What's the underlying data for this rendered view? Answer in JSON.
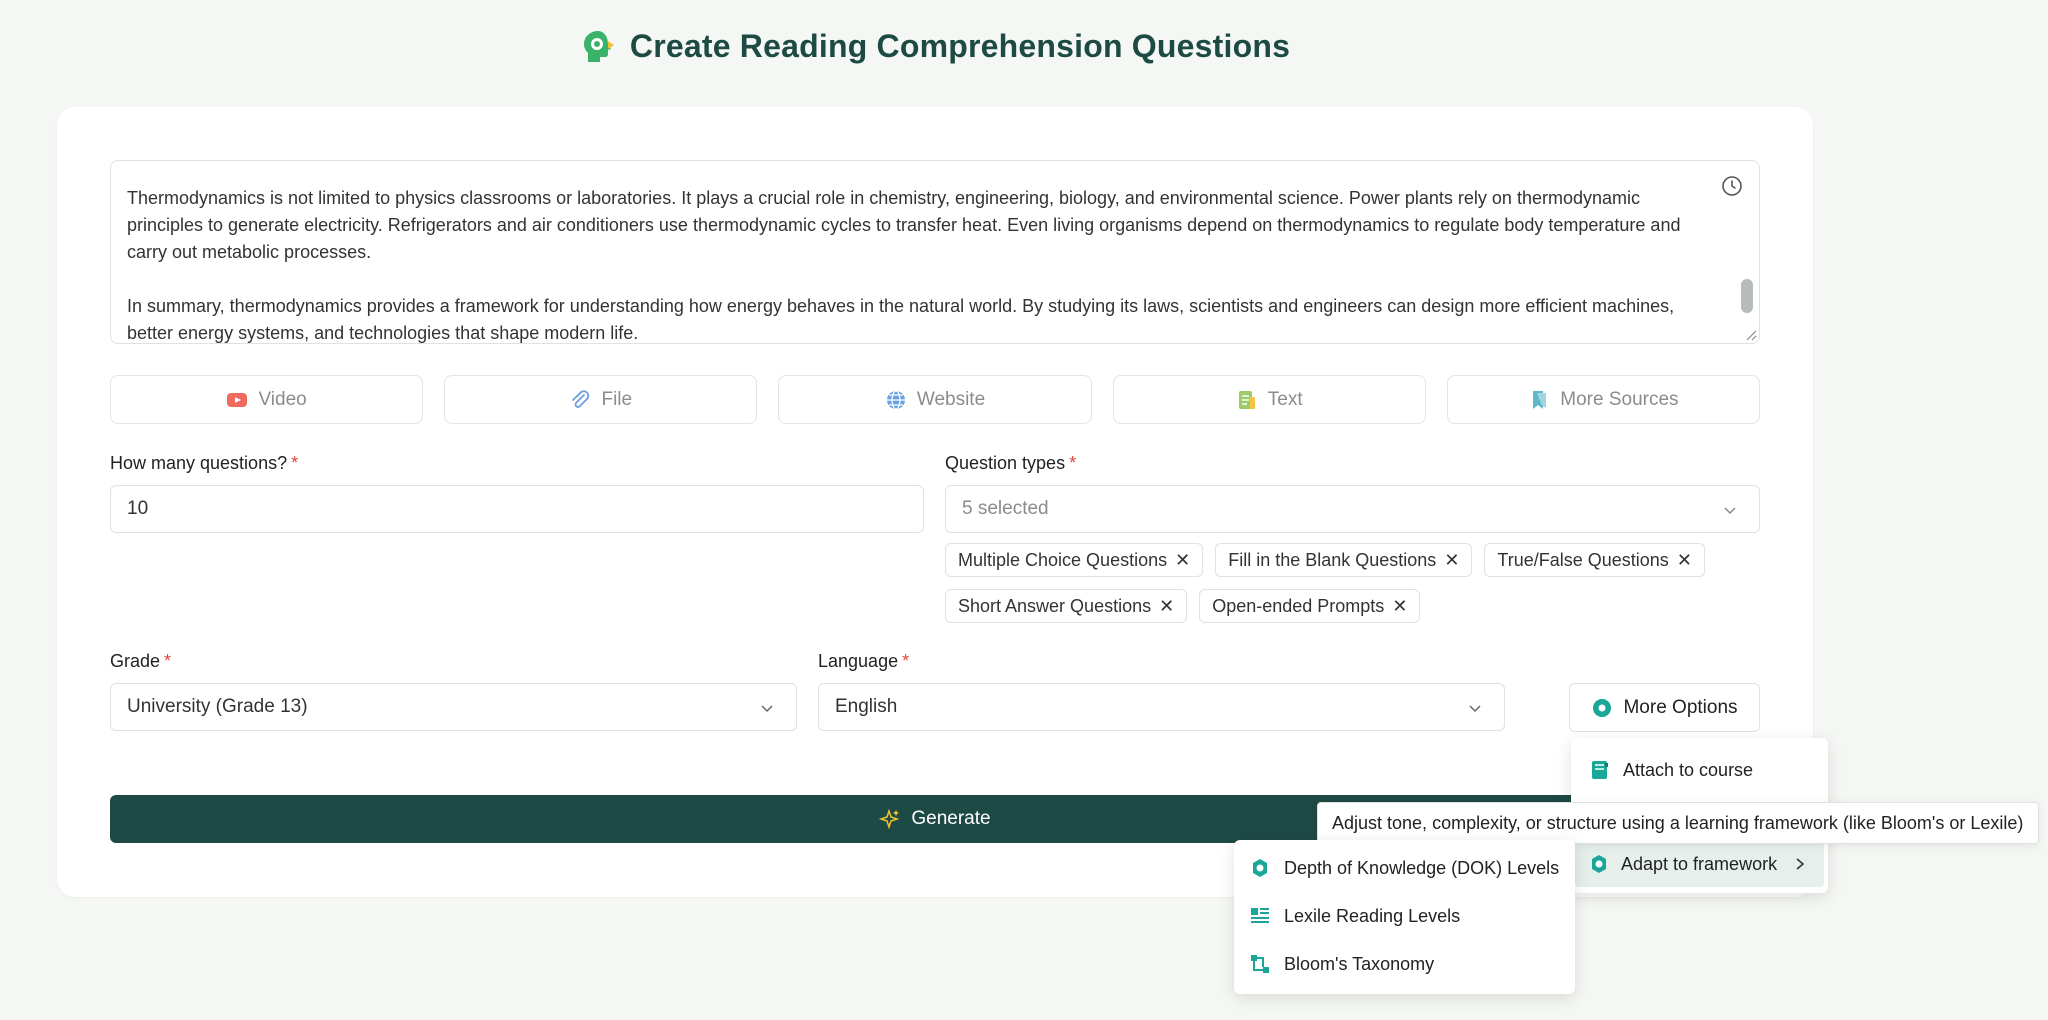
{
  "header": {
    "title": "Create Reading Comprehension Questions",
    "logo_icon": "head-gear-icon"
  },
  "source_text": {
    "paragraphs": [
      "Thermodynamics is not limited to physics classrooms or laboratories. It plays a crucial role in chemistry, engineering, biology, and environmental science. Power plants rely on thermodynamic principles to generate electricity. Refrigerators and air conditioners use thermodynamic cycles to transfer heat. Even living organisms depend on thermodynamics to regulate body temperature and carry out metabolic processes.",
      "In summary, thermodynamics provides a framework for understanding how energy behaves in the natural world. By studying its laws, scientists and engineers can design more efficient machines, better energy systems, and technologies that shape modern life."
    ]
  },
  "sources": [
    {
      "label": "Video",
      "icon": "youtube-icon"
    },
    {
      "label": "File",
      "icon": "paperclip-icon"
    },
    {
      "label": "Website",
      "icon": "globe-icon"
    },
    {
      "label": "Text",
      "icon": "text-document-icon"
    },
    {
      "label": "More Sources",
      "icon": "bookmark-icon"
    }
  ],
  "form": {
    "question_count": {
      "label": "How many questions?",
      "required_mark": "*",
      "value": "10"
    },
    "question_types": {
      "label": "Question types",
      "required_mark": "*",
      "placeholder": "5 selected",
      "chips": [
        "Multiple Choice Questions",
        "Fill in the Blank Questions",
        "True/False Questions",
        "Short Answer Questions",
        "Open-ended Prompts"
      ],
      "chip_remove": "✕"
    },
    "grade": {
      "label": "Grade",
      "required_mark": "*",
      "value": "University (Grade 13)"
    },
    "language": {
      "label": "Language",
      "required_mark": "*",
      "value": "English"
    },
    "more_options_label": "More Options",
    "generate_label": "Generate"
  },
  "more_menu": {
    "items": [
      {
        "label": "Attach to course",
        "icon": "notebook-icon"
      },
      {
        "label": "Adapt to framework",
        "icon": "framework-gear-icon"
      }
    ],
    "tooltip": "Adjust tone, complexity, or structure using a learning framework (like Bloom's or Lexile)"
  },
  "framework_submenu": {
    "items": [
      {
        "label": "Depth of Knowledge (DOK) Levels",
        "icon": "dok-icon"
      },
      {
        "label": "Lexile Reading Levels",
        "icon": "lexile-icon"
      },
      {
        "label": "Bloom's Taxonomy",
        "icon": "blooms-icon"
      }
    ]
  },
  "colors": {
    "brand_dark": "#1e4a45",
    "accent_teal": "#1aa79a",
    "required": "#e0453b"
  }
}
